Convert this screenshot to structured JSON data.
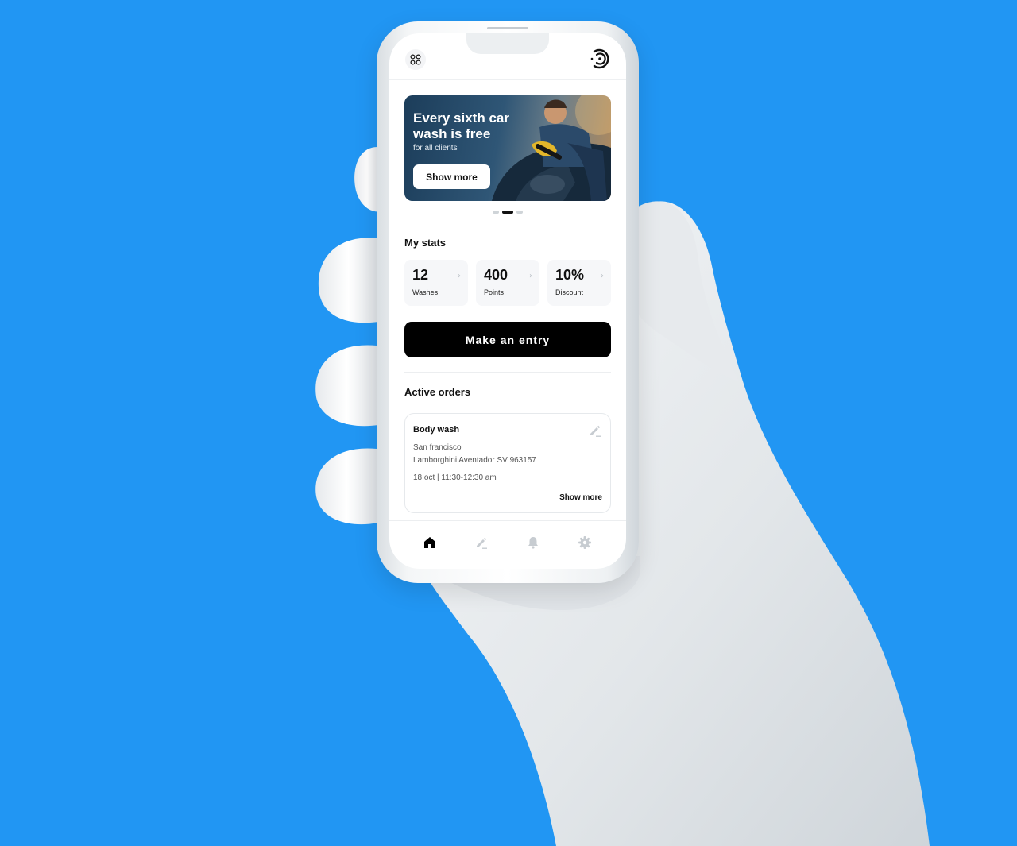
{
  "banner": {
    "title": "Every sixth car wash is free",
    "subtitle": "for all clients",
    "button_label": "Show more",
    "slides_total": 3,
    "active_slide": 2
  },
  "stats": {
    "title": "My stats",
    "items": [
      {
        "value": "12",
        "label": "Washes"
      },
      {
        "value": "400",
        "label": "Points"
      },
      {
        "value": "10%",
        "label": "Discount"
      }
    ]
  },
  "cta": {
    "label": "Make an entry"
  },
  "orders": {
    "title": "Active orders",
    "items": [
      {
        "service": "Body wash",
        "city": "San francisco",
        "car": "Lamborghini Aventador SV 963157",
        "datetime": "18 oct | 11:30-12:30 am",
        "more_label": "Show more"
      }
    ]
  },
  "nav": {
    "items": [
      {
        "icon": "home-icon",
        "active": true
      },
      {
        "icon": "edit-icon",
        "active": false
      },
      {
        "icon": "bell-icon",
        "active": false
      },
      {
        "icon": "gear-icon",
        "active": false
      }
    ]
  },
  "colors": {
    "background": "#2196F3",
    "primary": "#000000",
    "inactive_icon": "#c7ccd1"
  }
}
